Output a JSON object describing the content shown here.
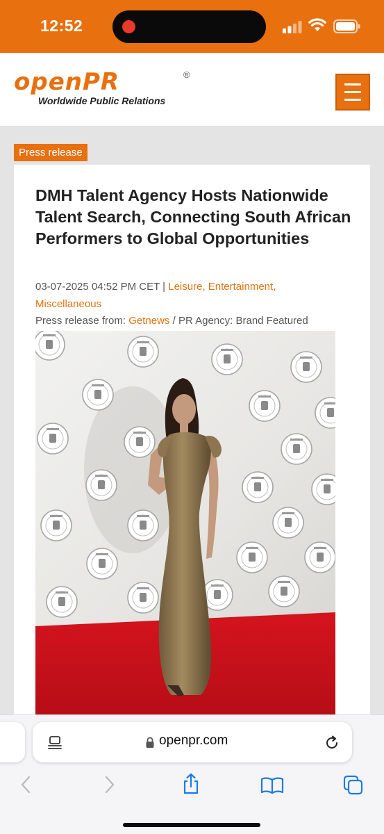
{
  "status_bar": {
    "time": "12:52",
    "icons": [
      "recording-dot-icon",
      "cellular-signal-icon",
      "wifi-icon",
      "battery-icon"
    ]
  },
  "site": {
    "logo_text": "openPR",
    "logo_registered": "®",
    "tagline": "Worldwide Public Relations",
    "brand_color": "#e8700f",
    "menu_icon": "hamburger-menu-icon"
  },
  "article": {
    "category_badge": "Press release",
    "title": "DMH Talent Agency Hosts Nationwide Talent Search, Connecting South African Performers to Global Opportunities",
    "date": "03-07-2025 04:52 PM CET",
    "separator": "|",
    "categories_line1": "Leisure, Entertainment,",
    "categories_line2": "Miscellaneous",
    "source_label": "Press release from:",
    "source": "Getnews",
    "agency_separator": "/",
    "agency": "PR Agency: Brand Featured",
    "link_color": "#e07214",
    "image": "photo of a woman in a gold gown on a red carpet in front of a logo backdrop"
  },
  "browser": {
    "url": "openpr.com",
    "icons": [
      "tab-overview-icon",
      "lock-icon",
      "reload-icon",
      "back-icon",
      "forward-icon",
      "share-icon",
      "bookmarks-icon",
      "tabs-icon"
    ]
  }
}
